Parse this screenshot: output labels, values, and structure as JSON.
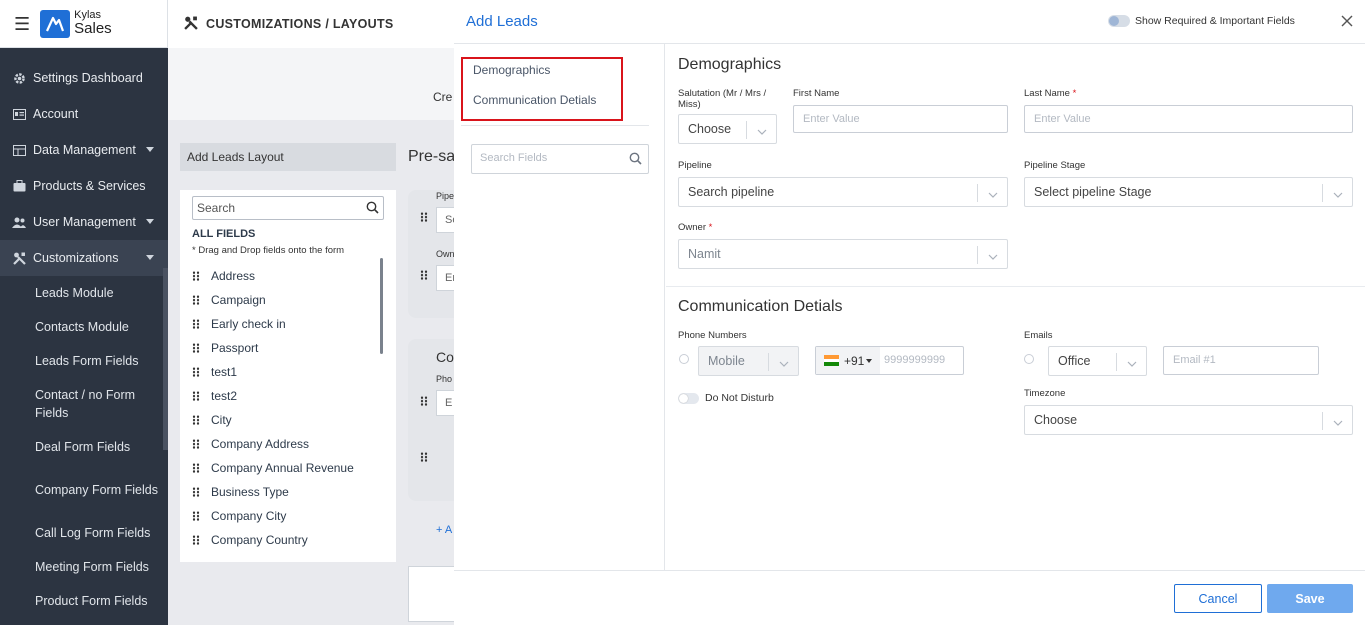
{
  "brand": {
    "line1": "Kylas",
    "line2": "Sales"
  },
  "sidebar": {
    "items": [
      {
        "label": "Settings Dashboard",
        "icon": "gear-icon"
      },
      {
        "label": "Account",
        "icon": "id-card-icon"
      },
      {
        "label": "Data Management",
        "icon": "table-icon"
      },
      {
        "label": "Products & Services",
        "icon": "briefcase-icon"
      },
      {
        "label": "User Management",
        "icon": "users-icon"
      },
      {
        "label": "Customizations",
        "icon": "tools-icon"
      }
    ],
    "sub_items": [
      "Leads Module",
      "Contacts Module",
      "Leads Form Fields",
      "Contact / no Form Fields",
      "Deal Form Fields",
      "Company Form Fields",
      "Call Log Form Fields",
      "Meeting Form Fields",
      "Product Form Fields"
    ]
  },
  "topbar": {
    "title": "CUSTOMIZATIONS / LAYOUTS"
  },
  "background": {
    "cre": "Cre",
    "layout_tab": "Add Leads Layout",
    "presa": "Pre-sa",
    "search": "Search",
    "all_fields": "ALL FIELDS",
    "drag_hint": "* Drag and Drop fields onto the form",
    "fields": [
      "Address",
      "Campaign",
      "Early check in",
      "Passport",
      "test1",
      "test2",
      "City",
      "Company Address",
      "Company Annual Revenue",
      "Business Type",
      "Company City",
      "Company Country"
    ],
    "card1": {
      "pipe": "Pipe",
      "se": "Se",
      "own": "Own",
      "en": "En"
    },
    "card2": {
      "co": "Co",
      "pho": "Pho",
      "e": "E"
    },
    "add": "+ A"
  },
  "modal": {
    "title": "Add Leads",
    "toggle_label": "Show Required & Important Fields",
    "sections": [
      "Demographics",
      "Communication Detials"
    ],
    "search_placeholder": "Search Fields",
    "demographics": {
      "title": "Demographics",
      "salutation_label": "Salutation (Mr / Mrs / Miss)",
      "salutation_value": "Choose",
      "first_name_label": "First Name",
      "first_name_placeholder": "Enter Value",
      "last_name_label": "Last Name",
      "last_name_placeholder": "Enter Value",
      "pipeline_label": "Pipeline",
      "pipeline_value": "Search pipeline",
      "stage_label": "Pipeline Stage",
      "stage_value": "Select pipeline Stage",
      "owner_label": "Owner",
      "owner_value": "Namit",
      "required_mark": "*"
    },
    "communication": {
      "title": "Communication Detials",
      "phone_label": "Phone Numbers",
      "phone_type": "Mobile",
      "country_code": "+91",
      "phone_placeholder": "9999999999",
      "dnd_label": "Do Not Disturb",
      "emails_label": "Emails",
      "email_type": "Office",
      "email_placeholder": "Email #1",
      "timezone_label": "Timezone",
      "timezone_value": "Choose"
    },
    "cancel": "Cancel",
    "save": "Save"
  },
  "colors": {
    "accent": "#1f6fd6",
    "sidebar": "#2c3441",
    "highlight": "#d9141b",
    "save": "#6fa9ee"
  }
}
